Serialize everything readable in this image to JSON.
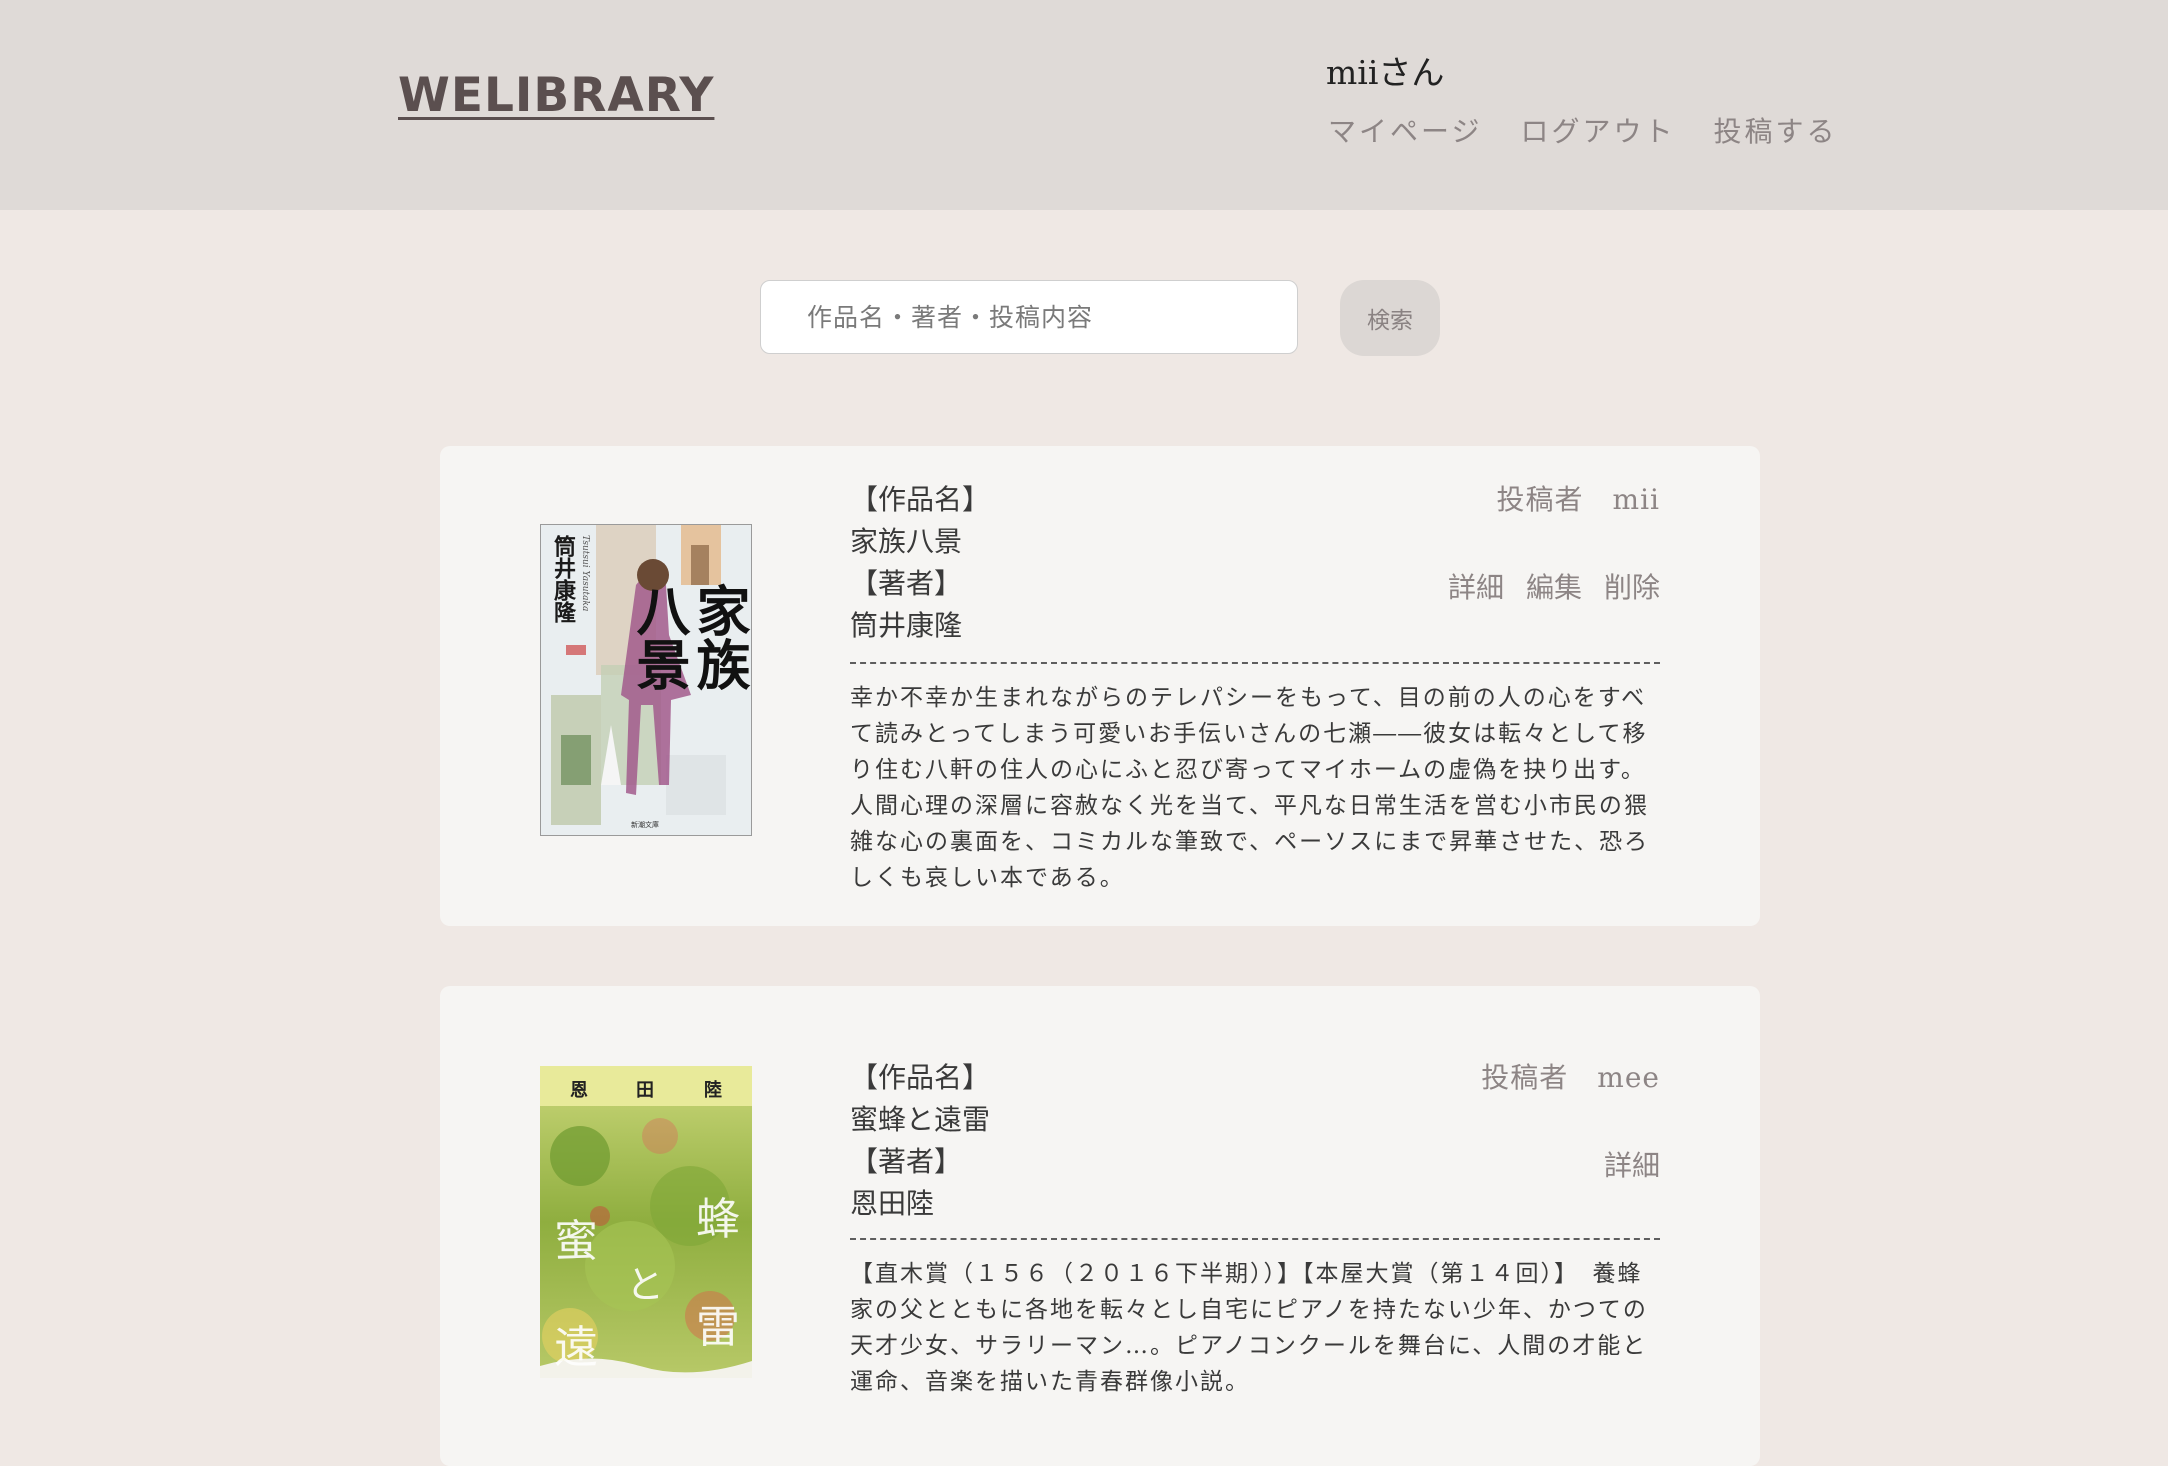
{
  "header": {
    "logo": "WELIBRARY",
    "username": "miiさん",
    "nav": {
      "mypage": "マイページ",
      "logout": "ログアウト",
      "post": "投稿する"
    }
  },
  "search": {
    "placeholder": "作品名・著者・投稿内容",
    "button_label": "検索"
  },
  "posts": [
    {
      "title_label": "【作品名】",
      "title": "家族八景",
      "author_label": "【著者】",
      "author": "筒井康隆",
      "poster": "投稿者　mii",
      "actions": {
        "detail": "詳細",
        "edit": "編集",
        "delete": "削除"
      },
      "description": "幸か不幸か生まれながらのテレパシーをもって、目の前の人の心をすべて読みとってしまう可愛いお手伝いさんの七瀬――彼女は転々として移り住む八軒の住人の心にふと忍び寄ってマイホームの虚偽を抉り出す。人間心理の深層に容赦なく光を当て、平凡な日常生活を営む小市民の猥雑な心の裏面を、コミカルな筆致で、ペーソスにまで昇華させた、恐ろしくも哀しい本である。",
      "cover": {
        "vertical_author": "筒井康隆",
        "romaji": "Tsutsui Yasutaka",
        "title_col1": "家族",
        "title_col2": "八景",
        "publisher": "新潮文庫",
        "accent": "#a25a8c"
      }
    },
    {
      "title_label": "【作品名】",
      "title": "蜜蜂と遠雷",
      "author_label": "【著者】",
      "author": "恩田陸",
      "poster": "投稿者　mee",
      "actions": {
        "detail": "詳細"
      },
      "description": "【直木賞（１５６（２０１６下半期））】【本屋大賞（第１４回）】　養蜂家の父とともに各地を転々とし自宅にピアノを持たない少年、かつての天才少女、サラリーマン…。ピアノコンクールを舞台に、人間の才能と運命、音楽を描いた青春群像小説。",
      "cover": {
        "author_chars": [
          "恩",
          "田",
          "陸"
        ],
        "title_chars": [
          "蜜",
          "蜂",
          "と",
          "遠",
          "雷"
        ],
        "accent": "#8aa83a"
      }
    }
  ],
  "colors": {
    "header_bg": "#dfdad7",
    "page_bg": "#efe8e4",
    "card_bg": "#f6f5f3",
    "logo": "#5b4f4f",
    "muted_text": "#8d8585"
  }
}
